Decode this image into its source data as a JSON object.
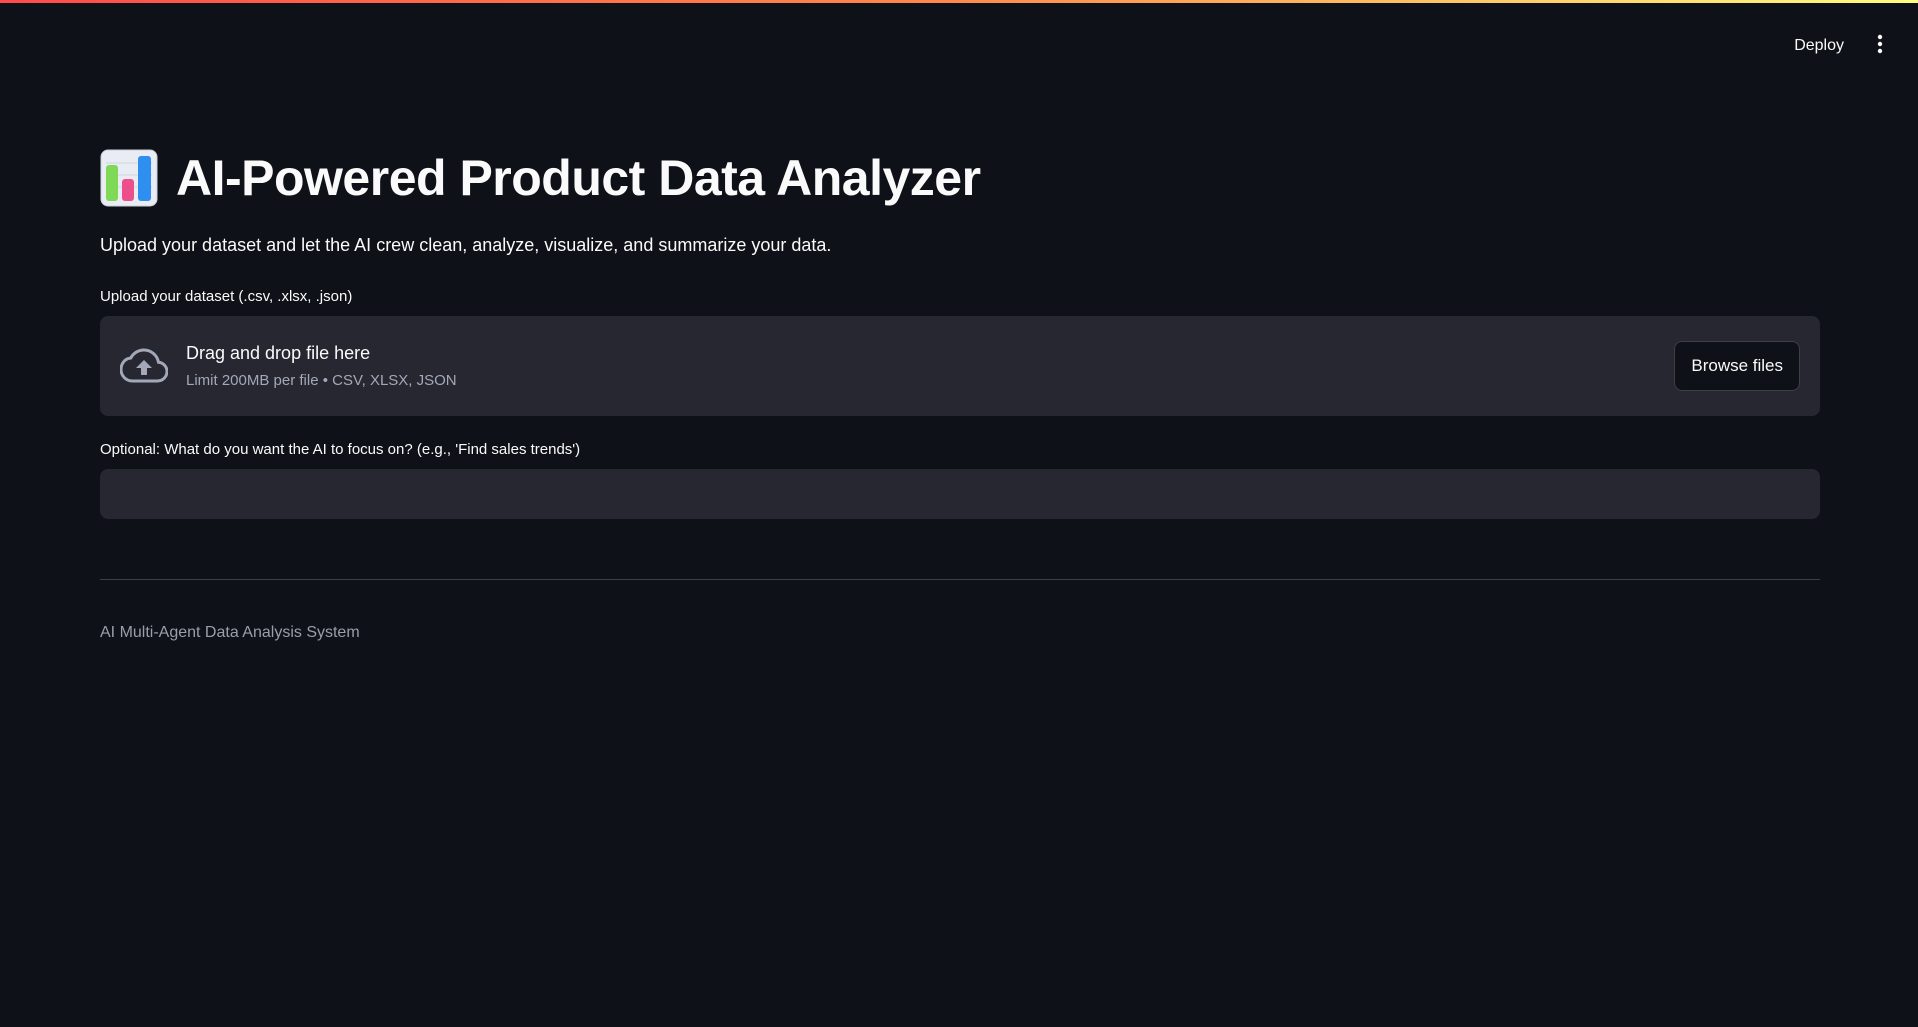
{
  "header": {
    "deploy_label": "Deploy",
    "menu_icon": "kebab-menu-icon"
  },
  "main": {
    "title_icon": "bar-chart-emoji-icon",
    "title": "AI-Powered Product Data Analyzer",
    "subtitle": "Upload your dataset and let the AI crew clean, analyze, visualize, and summarize your data.",
    "uploader": {
      "label": "Upload your dataset (.csv, .xlsx, .json)",
      "icon": "cloud-upload-icon",
      "drop_text": "Drag and drop file here",
      "limit_text": "Limit 200MB per file • CSV, XLSX, JSON",
      "browse_label": "Browse files"
    },
    "focus": {
      "label": "Optional: What do you want the AI to focus on? (e.g., 'Find sales trends')",
      "value": "",
      "placeholder": ""
    },
    "footer_caption": "AI Multi-Agent Data Analysis System"
  },
  "colors": {
    "background": "#0e1117",
    "surface": "#262730",
    "text": "#fafafa",
    "muted_text": "#a3a8b8",
    "decoration_start": "#ff4b4b",
    "decoration_end": "#fffd80"
  }
}
